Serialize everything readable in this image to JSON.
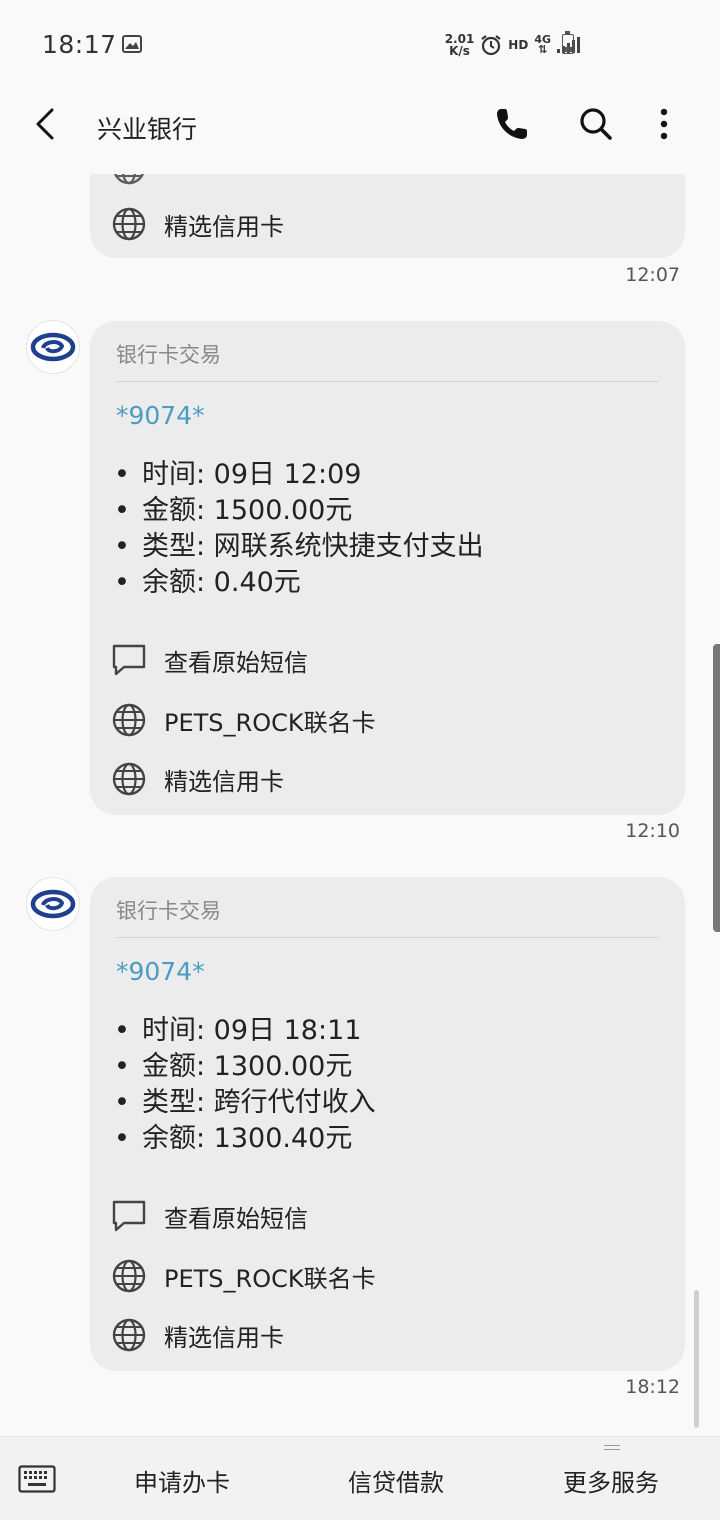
{
  "status_bar": {
    "time": "18:17",
    "net_speed_value": "2.01",
    "net_speed_unit": "K/s",
    "hd": "HD",
    "network": "4G",
    "icons": [
      "image-icon",
      "alarm-icon",
      "signal-icon",
      "battery-icon"
    ]
  },
  "app_bar": {
    "title": "兴业银行",
    "icons": [
      "back-arrow-icon",
      "phone-icon",
      "search-icon",
      "more-vert-icon"
    ]
  },
  "prev_message": {
    "action_label": "精选信用卡",
    "timestamp": "12:07"
  },
  "messages": [
    {
      "header": "银行卡交易",
      "card": "*9074*",
      "rows": [
        {
          "bullet": "•",
          "text": "时间: 09日 12:09"
        },
        {
          "bullet": "•",
          "text": "金额: 1500.00元"
        },
        {
          "bullet": "•",
          "text": "类型: 网联系统快捷支付支出"
        },
        {
          "bullet": "•",
          "text": "余额: 0.40元"
        }
      ],
      "actions": [
        {
          "label": "查看原始短信",
          "icon": "message-icon"
        },
        {
          "label": "PETS_ROCK联名卡",
          "icon": "globe-icon"
        },
        {
          "label": "精选信用卡",
          "icon": "globe-icon"
        }
      ],
      "timestamp": "12:10"
    },
    {
      "header": "银行卡交易",
      "card": "*9074*",
      "rows": [
        {
          "bullet": "•",
          "text": "时间: 09日 18:11"
        },
        {
          "bullet": "•",
          "text": "金额: 1300.00元"
        },
        {
          "bullet": "•",
          "text": "类型: 跨行代付收入"
        },
        {
          "bullet": "•",
          "text": "余额: 1300.40元"
        }
      ],
      "actions": [
        {
          "label": "查看原始短信",
          "icon": "message-icon"
        },
        {
          "label": "PETS_ROCK联名卡",
          "icon": "globe-icon"
        },
        {
          "label": "精选信用卡",
          "icon": "globe-icon"
        }
      ],
      "timestamp": "18:12"
    }
  ],
  "bottom_menu": {
    "keyboard_icon": "keyboard-icon",
    "items": [
      "申请办卡",
      "信贷借款",
      "更多服务"
    ]
  },
  "colors": {
    "bubble": "#ececec",
    "card_number": "#4a9cc0",
    "bank_logo": "#1f3f8f"
  }
}
